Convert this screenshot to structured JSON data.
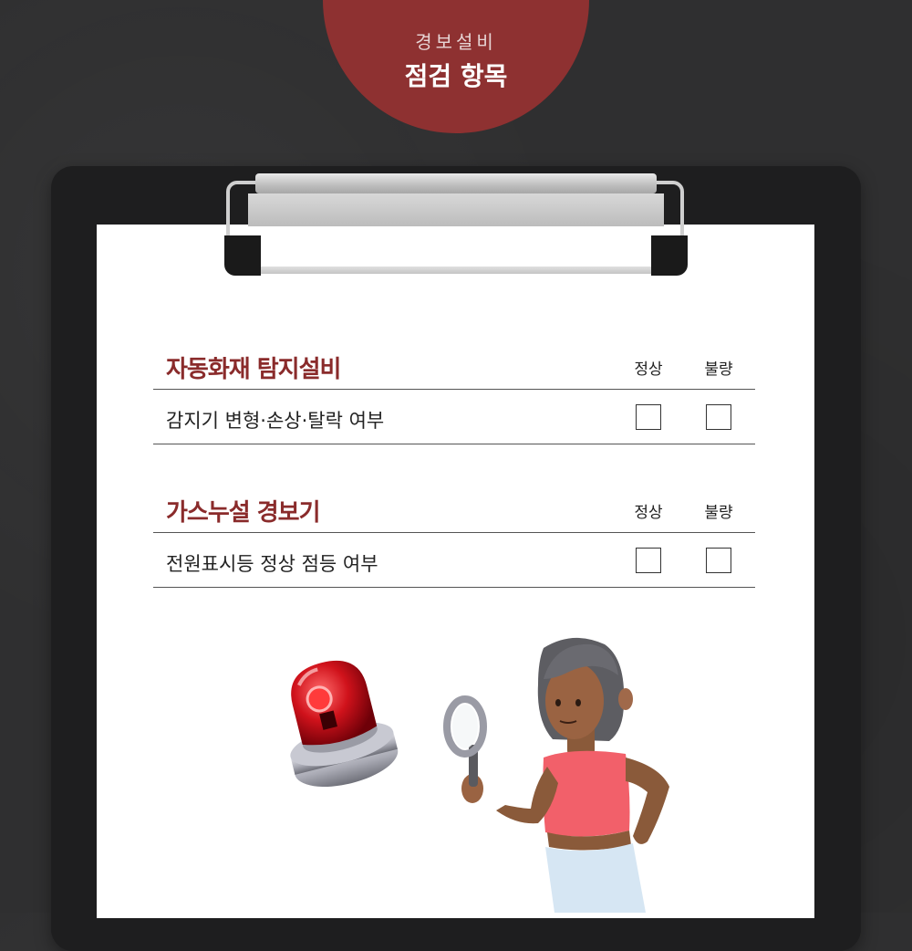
{
  "header": {
    "subtitle": "경보설비",
    "title": "점검 항목"
  },
  "sections": [
    {
      "title": "자동화재 탐지설비",
      "columns": [
        "정상",
        "불량"
      ],
      "items": [
        {
          "label": "감지기 변형·손상·탈락 여부",
          "normal": false,
          "defective": false
        }
      ]
    },
    {
      "title": "가스누설 경보기",
      "columns": [
        "정상",
        "불량"
      ],
      "items": [
        {
          "label": "전원표시등 정상 점등 여부",
          "normal": false,
          "defective": false
        }
      ]
    }
  ],
  "colors": {
    "background": "#2f2f30",
    "accent": "#8e3131",
    "section_title": "#8a2b2b",
    "paper": "#ffffff"
  }
}
